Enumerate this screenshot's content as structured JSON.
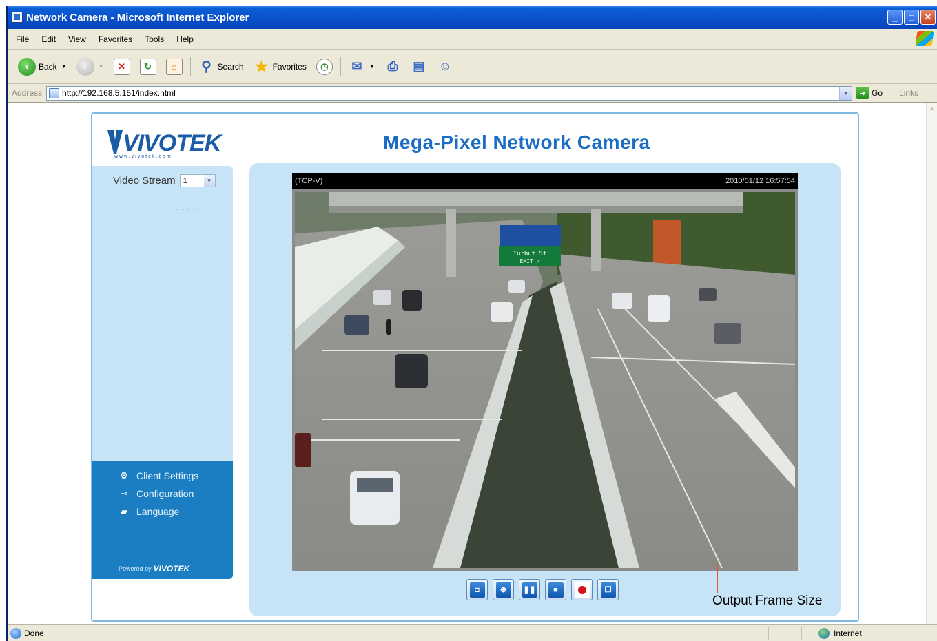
{
  "window": {
    "title": "Network Camera - Microsoft Internet Explorer",
    "controls": {
      "minimize": "_",
      "maximize": "□",
      "close": "✕"
    }
  },
  "menu": [
    "File",
    "Edit",
    "View",
    "Favorites",
    "Tools",
    "Help"
  ],
  "toolbar": {
    "back_label": "Back",
    "search_label": "Search",
    "favorites_label": "Favorites"
  },
  "address": {
    "label": "Address",
    "url": "http://192.168.5.151/index.html",
    "go_label": "Go",
    "links_label": "Links"
  },
  "page": {
    "logo_text": "VIVOTEK",
    "logo_sub": "www.vivotek.com",
    "title": "Mega-Pixel Network Camera",
    "stream_label": "Video Stream",
    "stream_value": "1",
    "stream_dots": "- - - -",
    "menu_items": [
      {
        "label": "Client Settings",
        "icon": "gear-icon"
      },
      {
        "label": "Configuration",
        "icon": "wrench-icon"
      },
      {
        "label": "Language",
        "icon": "speech-bubble-icon"
      }
    ],
    "powered_by": "Powered by",
    "powered_brand": "VIVOTEK"
  },
  "video": {
    "protocol": "(TCP-V)",
    "timestamp": "2010/01/12 16:57:54",
    "sign_text": "Turbut St",
    "sign_sub": "EXIT ↗"
  },
  "controls": [
    {
      "name": "snapshot-button",
      "icon": "camera-icon"
    },
    {
      "name": "digital-zoom-button",
      "icon": "zoom-icon"
    },
    {
      "name": "pause-button",
      "icon": "pause-icon"
    },
    {
      "name": "stop-button",
      "icon": "stop-icon"
    },
    {
      "name": "record-button",
      "icon": "record-icon"
    },
    {
      "name": "volume-button",
      "icon": "window-icon"
    }
  ],
  "annotation": {
    "output_frame_size": "Output Frame Size"
  },
  "status": {
    "done": "Done",
    "zone": "Internet"
  },
  "colors": {
    "title_blue": "#1a6cc4",
    "sidebar_light": "#c7e4f7",
    "sidebar_dark": "#1b7ec2",
    "callout": "#e0583a"
  }
}
